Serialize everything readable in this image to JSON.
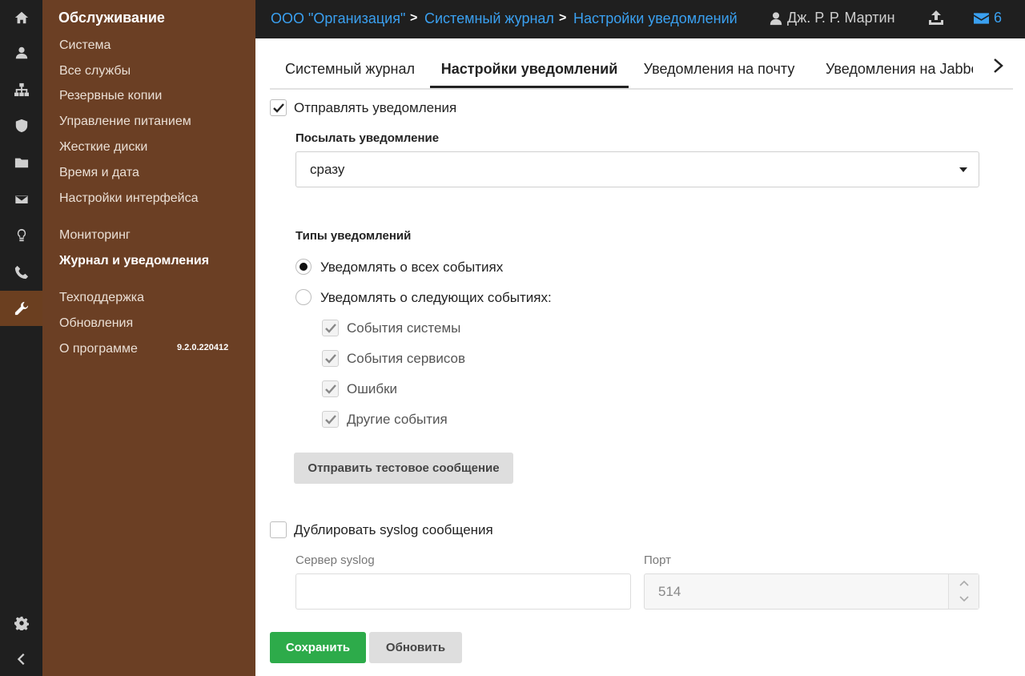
{
  "rail": {
    "icons": [
      "home-icon",
      "user-icon",
      "network-icon",
      "shield-icon",
      "folder-icon",
      "mail-icon",
      "lightbulb-icon",
      "phone-icon",
      "wrench-icon",
      "gear-icon",
      "collapse-icon"
    ]
  },
  "menu": {
    "title": "Обслуживание",
    "items": [
      {
        "label": "Система"
      },
      {
        "label": "Все службы"
      },
      {
        "label": "Резервные копии"
      },
      {
        "label": "Управление питанием"
      },
      {
        "label": "Жесткие диски"
      },
      {
        "label": "Время и дата"
      },
      {
        "label": "Настройки интерфейса"
      },
      {
        "label": "Мониторинг"
      },
      {
        "label": "Журнал и уведомления"
      },
      {
        "label": "Техподдержка"
      },
      {
        "label": "Обновления"
      },
      {
        "label": "О программе"
      }
    ],
    "version": "9.2.0.220412"
  },
  "topbar": {
    "breadcrumb": [
      "ООО \"Организация\"",
      "Системный журнал",
      "Настройки уведомлений"
    ],
    "separator": ">",
    "user": "Дж. Р. Р. Мартин",
    "mail_count": "6"
  },
  "tabs": [
    {
      "label": "Системный журнал"
    },
    {
      "label": "Настройки уведомлений"
    },
    {
      "label": "Уведомления на почту"
    },
    {
      "label": "Уведомления на Jabber"
    }
  ],
  "form": {
    "send_notifications_label": "Отправлять уведомления",
    "send_when_label": "Посылать уведомление",
    "send_when_value": "сразу",
    "types_label": "Типы уведомлений",
    "radio_all": "Уведомлять о всех событиях",
    "radio_selected": "Уведомлять о следующих событиях:",
    "events": [
      {
        "label": "События системы"
      },
      {
        "label": "События сервисов"
      },
      {
        "label": "Ошибки"
      },
      {
        "label": "Другие события"
      }
    ],
    "test_button": "Отправить тестовое сообщение",
    "syslog_label": "Дублировать syslog сообщения",
    "syslog_server_label": "Сервер syslog",
    "syslog_server_value": "",
    "port_label": "Порт",
    "port_value": "514"
  },
  "actions": {
    "save": "Сохранить",
    "refresh": "Обновить"
  },
  "colors": {
    "menu_bg": "#6b3f24",
    "topbar_bg": "#1f1f1f",
    "link": "#3aa0f0",
    "save": "#2dab4a"
  }
}
